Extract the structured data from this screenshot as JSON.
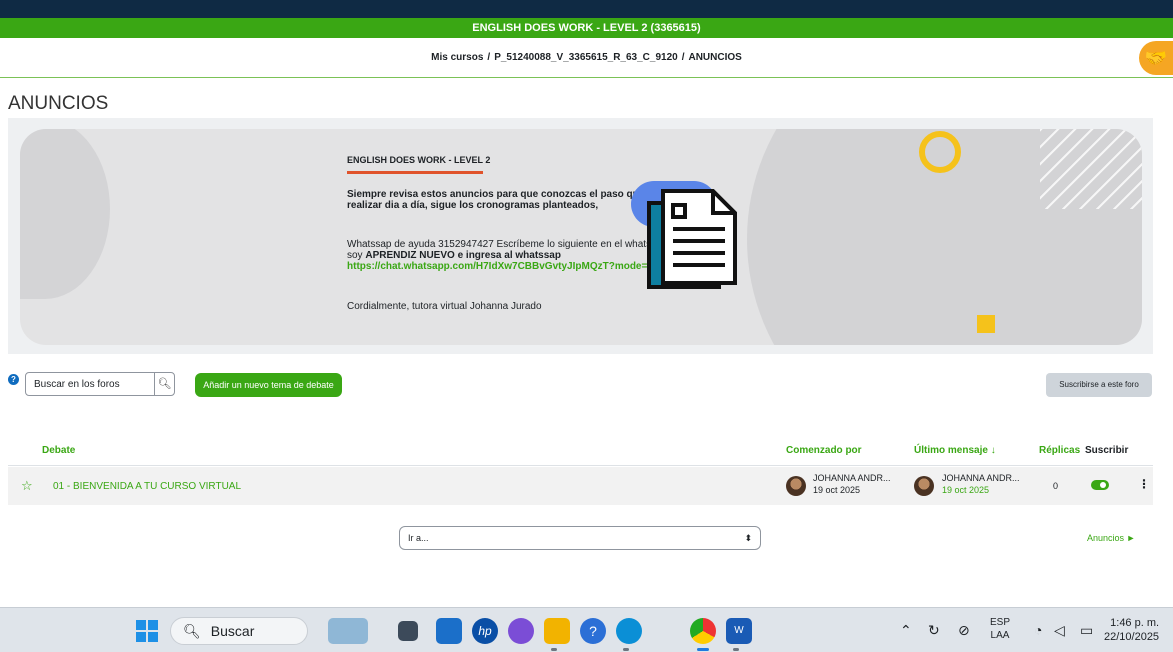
{
  "course_title": "ENGLISH DOES WORK - LEVEL 2 (3365615)",
  "breadcrumb": {
    "items": [
      "Mis cursos",
      "P_51240088_V_3365615_R_63_C_9120",
      "ANUNCIOS"
    ],
    "separator": "/"
  },
  "page_title": "ANUNCIOS",
  "banner": {
    "title": "ENGLISH DOES WORK - LEVEL 2",
    "bold_text": "Siempre revisa estos anuncios para que conozcas el paso que debes realizar dia a día, sigue los cronogramas planteados,",
    "wa_text_1": "Whatssap de ayuda 3152947427 Escríbeme lo siguiente en el whatssap soy ",
    "wa_bold_1": "APRENDIZ NUEVO",
    "wa_bold_2": " e ingresa al whatssap ",
    "wa_link": "https://chat.whatsapp.com/H7IdXw7CBBvGvtyJIpMQzT?mode=wwt",
    "signature": "Cordialmente, tutora virtual Johanna Jurado"
  },
  "toolbar": {
    "search_placeholder": "Buscar en los foros",
    "add_topic": "Añadir un nuevo tema de debate",
    "subscribe": "Suscribirse a este foro"
  },
  "table": {
    "headers": {
      "debate": "Debate",
      "started_by": "Comenzado por",
      "last_post": "Último mensaje ↓",
      "replies": "Réplicas",
      "subscribe": "Suscribir"
    },
    "rows": [
      {
        "topic": "01 - BIENVENIDA A TU CURSO VIRTUAL",
        "started_by": "JOHANNA ANDR...",
        "started_date": "19 oct 2025",
        "last_by": "JOHANNA ANDR...",
        "last_date": "19 oct 2025",
        "replies": "0",
        "subscribed": true
      }
    ]
  },
  "jump_to": {
    "label": "Ir a..."
  },
  "next_link": "Anuncios ►",
  "taskbar": {
    "search": "Buscar",
    "lang_1": "ESP",
    "lang_2": "LAA",
    "time": "1:46 p. m.",
    "date": "22/10/2025"
  },
  "colors": {
    "accent": "#3aa714",
    "dark_header": "#0f2a44",
    "fab": "#f5a623"
  }
}
